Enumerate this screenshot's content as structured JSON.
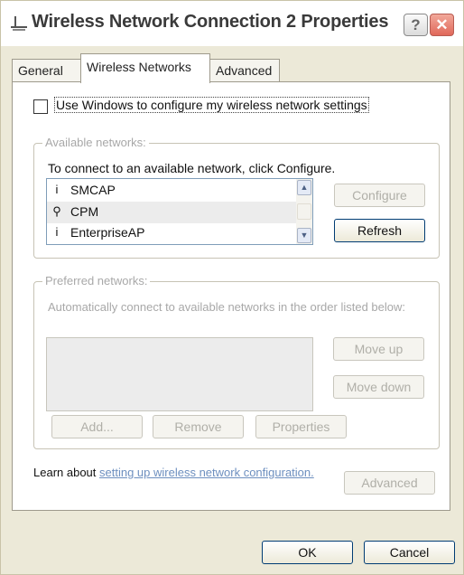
{
  "window": {
    "title": "Wireless Network Connection 2 Properties",
    "help_glyph": "?",
    "close_glyph": "✕"
  },
  "tabs": [
    {
      "label": "General"
    },
    {
      "label": "Wireless Networks"
    },
    {
      "label": "Advanced"
    }
  ],
  "wireless_config": {
    "checkbox_label": "Use Windows to configure my wireless network settings",
    "checked": false
  },
  "available_networks": {
    "legend": "Available networks:",
    "instruction": "To connect to an available network, click Configure.",
    "items": [
      {
        "label": "SMCAP",
        "icon": "infrastructure-network-icon",
        "glyph": "i"
      },
      {
        "label": "CPM",
        "icon": "ad-hoc-network-icon",
        "glyph": "⚲"
      },
      {
        "label": "EnterpriseAP",
        "icon": "infrastructure-network-icon",
        "glyph": "i"
      }
    ],
    "configure_label": "Configure",
    "refresh_label": "Refresh"
  },
  "preferred_networks": {
    "legend": "Preferred networks:",
    "description": "Automatically connect to available networks in the order listed below:",
    "move_up_label": "Move up",
    "move_down_label": "Move down",
    "add_label": "Add...",
    "remove_label": "Remove",
    "properties_label": "Properties"
  },
  "learn_about": {
    "prefix": "Learn about ",
    "link": "setting up wireless network configuration."
  },
  "advanced_label": "Advanced",
  "ok_label": "OK",
  "cancel_label": "Cancel"
}
